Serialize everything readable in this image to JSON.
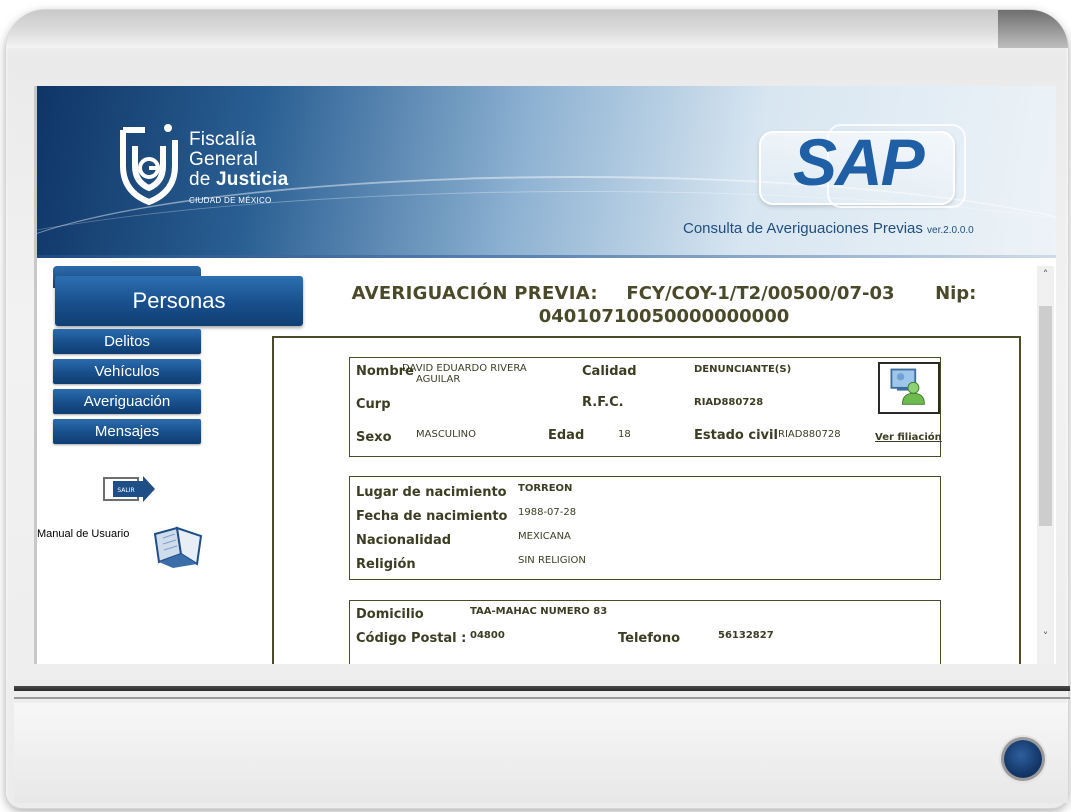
{
  "header": {
    "logo_line1": "Fiscalía",
    "logo_line2": "General",
    "logo_line3_prefix": "de ",
    "logo_line3_bold": "Justicia",
    "logo_line4": "CIUDAD DE MÉXICO",
    "app_name": "SAP",
    "app_subtitle": "Consulta de Averiguaciones Previas ",
    "app_version": "ver.2.0.0.0"
  },
  "sidebar": {
    "active_section": "Personas",
    "items": [
      {
        "label": "Delitos"
      },
      {
        "label": "Vehículos"
      },
      {
        "label": "Averiguación"
      },
      {
        "label": "Mensajes"
      }
    ],
    "exit_label": "SALIR",
    "manual_label": "Manual de Usuario"
  },
  "content": {
    "title_label": "AVERIGUACIÓN PREVIA:",
    "case_number": "FCY/COY-1/T2/00500/07-03",
    "nip_label": "Nip:",
    "nip_value": "04010710050000000000"
  },
  "person": {
    "nombre_label": "Nombre",
    "nombre_value_l1": "DAVID EDUARDO RIVERA",
    "nombre_value_l2": "AGUILAR",
    "calidad_label": "Calidad",
    "calidad_value": "DENUNCIANTE(S)",
    "curp_label": "Curp",
    "rfc_label": "R.F.C.",
    "rfc_value": "RIAD880728",
    "sexo_label": "Sexo",
    "sexo_value": "MASCULINO",
    "edad_label": "Edad",
    "edad_value": "18",
    "estado_civil_label": "Estado civil",
    "estado_civil_value": "RIAD880728",
    "ver_filiacion": "Ver filiación"
  },
  "birth": {
    "lugar_label": "Lugar de nacimiento",
    "lugar_value": "TORREON",
    "fecha_label": "Fecha de nacimiento",
    "fecha_value": "1988-07-28",
    "nacionalidad_label": "Nacionalidad",
    "nacionalidad_value": "MEXICANA",
    "religion_label": "Religión",
    "religion_value": "SIN RELIGION"
  },
  "address": {
    "domicilio_label": "Domicilio",
    "domicilio_value": "TAA-MAHAC NUMERO 83",
    "cp_label": "Código Postal :",
    "cp_value": "04800",
    "telefono_label": "Telefono",
    "telefono_value": "56132827"
  },
  "scrollbar": {
    "up_icon": "chevron-up-icon",
    "down_icon": "chevron-down-icon"
  },
  "colors": {
    "nav_blue": "#164c87",
    "sap_blue": "#1f5fa6",
    "text_olive": "#3d3d24"
  }
}
